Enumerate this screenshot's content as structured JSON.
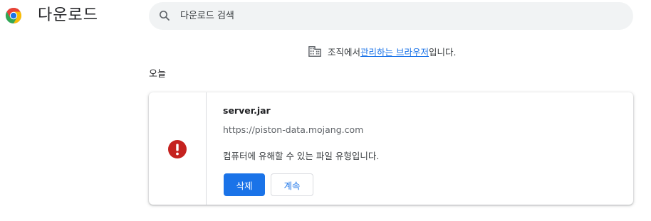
{
  "header": {
    "title": "다운로드",
    "logo_icon": "chrome-logo-icon"
  },
  "search": {
    "placeholder": "다운로드 검색",
    "icon": "search-icon"
  },
  "managed_notice": {
    "icon": "building-icon",
    "prefix": "조직에서 ",
    "link_text": "관리하는 브라우저",
    "suffix": "입니다."
  },
  "date_group": {
    "label": "오늘"
  },
  "downloads": [
    {
      "file_name": "server.jar",
      "url": "https://piston-data.mojang.com",
      "warning": "컴퓨터에 유해할 수 있는 파일 유형입니다.",
      "status_icon": "warning-icon",
      "delete_label": "삭제",
      "keep_label": "계속"
    }
  ],
  "colors": {
    "accent": "#1a73e8",
    "danger": "#d93025",
    "search_bg": "#f1f3f4",
    "divider": "#dadce0"
  }
}
